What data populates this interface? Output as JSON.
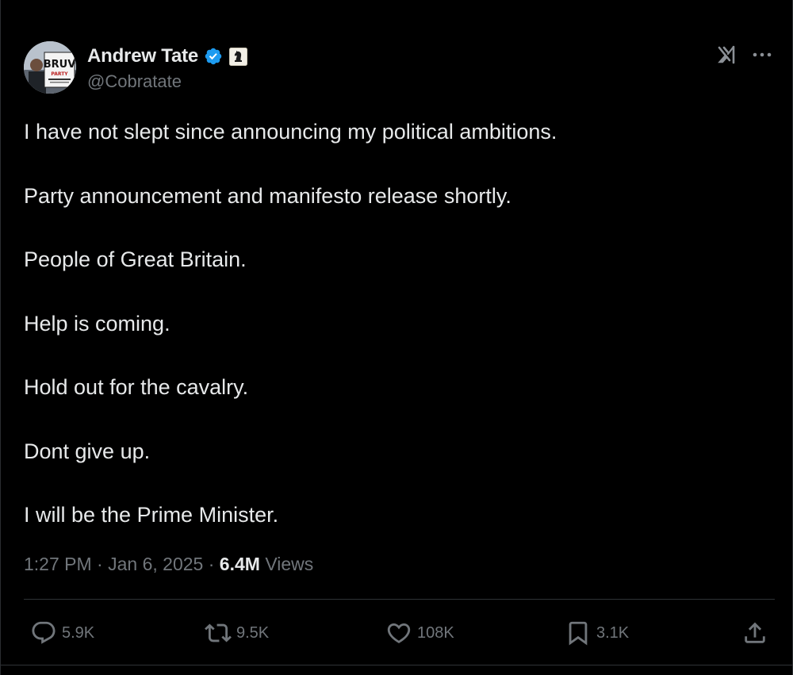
{
  "author": {
    "display_name": "Andrew Tate",
    "handle": "@Cobratate",
    "avatar": {
      "sign_text": "BRUV",
      "sub_text": "PARTY"
    },
    "verified_icon": "verified-badge-icon",
    "affiliate_icon": "chess-knight-icon"
  },
  "header_icons": {
    "grok": "grok-icon",
    "more": "more-horizontal-icon"
  },
  "tweet": {
    "lines": [
      "I have not slept since announcing my political ambitions.",
      "Party announcement and manifesto release shortly.",
      "People of Great Britain.",
      "Help is coming.",
      "Hold out for the cavalry.",
      "Dont give up.",
      "I will be the Prime Minister."
    ]
  },
  "meta": {
    "time": "1:27 PM",
    "separator": "·",
    "date": "Jan 6, 2025",
    "views_count": "6.4M",
    "views_label": "Views"
  },
  "actions": {
    "replies": "5.9K",
    "retweets": "9.5K",
    "likes": "108K",
    "bookmarks": "3.1K"
  },
  "colors": {
    "background": "#000000",
    "primary_text": "#e7e9ea",
    "secondary_text": "#71767b",
    "verified_blue": "#1d9bf0",
    "divider": "#2f3336"
  }
}
